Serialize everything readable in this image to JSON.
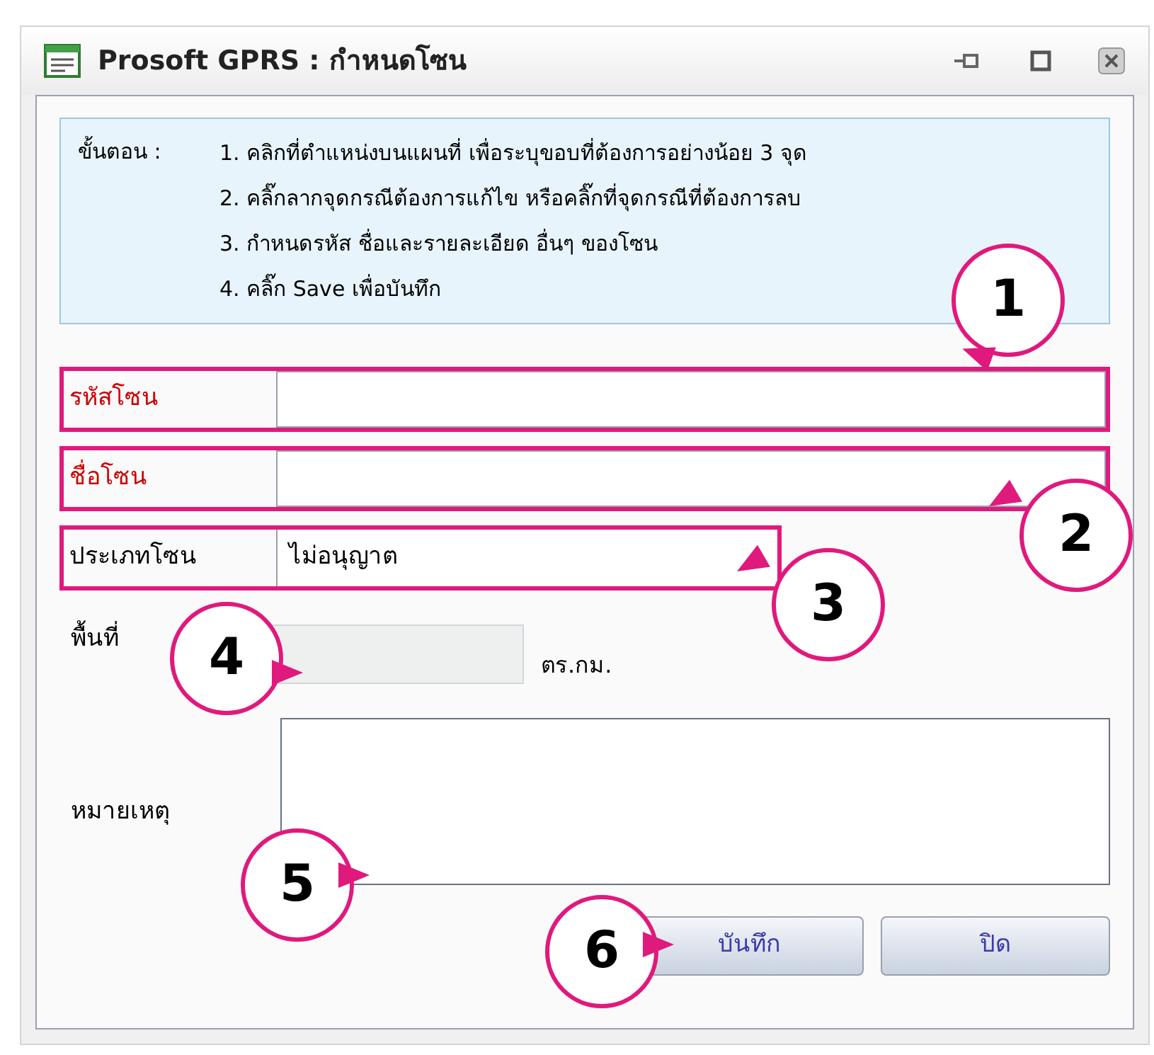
{
  "window": {
    "title": "Prosoft GPRS : กำหนดโซน"
  },
  "instructions": {
    "label": "ขั้นตอน :",
    "steps": [
      "1. คลิกที่ตำแหน่งบนแผนที่ เพื่อระบุขอบที่ต้องการอย่างน้อย 3 จุด",
      "2. คลิ๊กลากจุดกรณีต้องการแก้ไข หรือคลิ๊กที่จุดกรณีที่ต้องการลบ",
      "3. กำหนดรหัส ชื่อและรายละเอียด อื่นๆ ของโซน",
      "4. คลิ๊ก Save เพื่อบันทึก"
    ]
  },
  "fields": [
    {
      "kind": "text",
      "label": "รหัสโซน",
      "required": true,
      "highlighted": true
    },
    {
      "kind": "text",
      "label": "ชื่อโซน",
      "required": true,
      "highlighted": true
    },
    {
      "kind": "select",
      "label": "ประเภทโซน",
      "value": "ไม่อนุญาต",
      "required": false,
      "highlighted": true
    },
    {
      "kind": "area",
      "label": "พื้นที่",
      "unit": "ตร.กม.",
      "disabled": true
    },
    {
      "kind": "textarea",
      "label": "หมายเหตุ"
    }
  ],
  "buttons": [
    "บันทึก",
    "ปิด"
  ],
  "callouts": [
    "1",
    "2",
    "3",
    "4",
    "5",
    "6"
  ]
}
